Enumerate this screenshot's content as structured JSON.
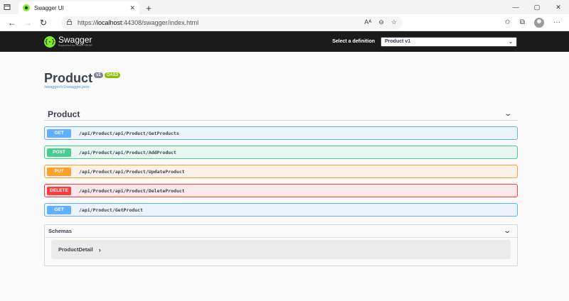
{
  "browser": {
    "tab_title": "Swagger UI",
    "tab_close": "✕",
    "new_tab": "+",
    "url_prefix": "https://",
    "url_host": "localhost",
    "url_rest": ":44308/swagger/index.html"
  },
  "topbar": {
    "logo_mark": "{-}",
    "logo_title": "Swagger",
    "logo_sub": "Supported by SMARTBEAR",
    "definition_label": "Select a definition",
    "definition_value": "Product v1"
  },
  "info": {
    "title": "Product",
    "version_badge": "v1",
    "oas_badge": "OAS3",
    "spec_link": "/swagger/v1/swagger.json"
  },
  "tag": {
    "name": "Product"
  },
  "operations": [
    {
      "method": "GET",
      "path": "/api/Product/api/Product/GetProducts",
      "color": "#61affe",
      "bg": "#ebf3fb",
      "border": "#61affe"
    },
    {
      "method": "POST",
      "path": "/api/Product/api/Product/AddProduct",
      "color": "#49cc90",
      "bg": "#e8f6f0",
      "border": "#49cc90"
    },
    {
      "method": "PUT",
      "path": "/api/Product/api/Product/UpdateProduct",
      "color": "#fca130",
      "bg": "#fbf1e6",
      "border": "#fca130"
    },
    {
      "method": "DELETE",
      "path": "/api/Product/api/Product/DeleteProduct",
      "color": "#f93e3e",
      "bg": "#fae7e7",
      "border": "#f93e3e"
    },
    {
      "method": "GET",
      "path": "/api/Product/GetProduct",
      "color": "#61affe",
      "bg": "#ebf3fb",
      "border": "#61affe"
    }
  ],
  "schemas": {
    "title": "Schemas",
    "models": [
      {
        "name": "ProductDetail",
        "arrow": "›"
      }
    ]
  }
}
